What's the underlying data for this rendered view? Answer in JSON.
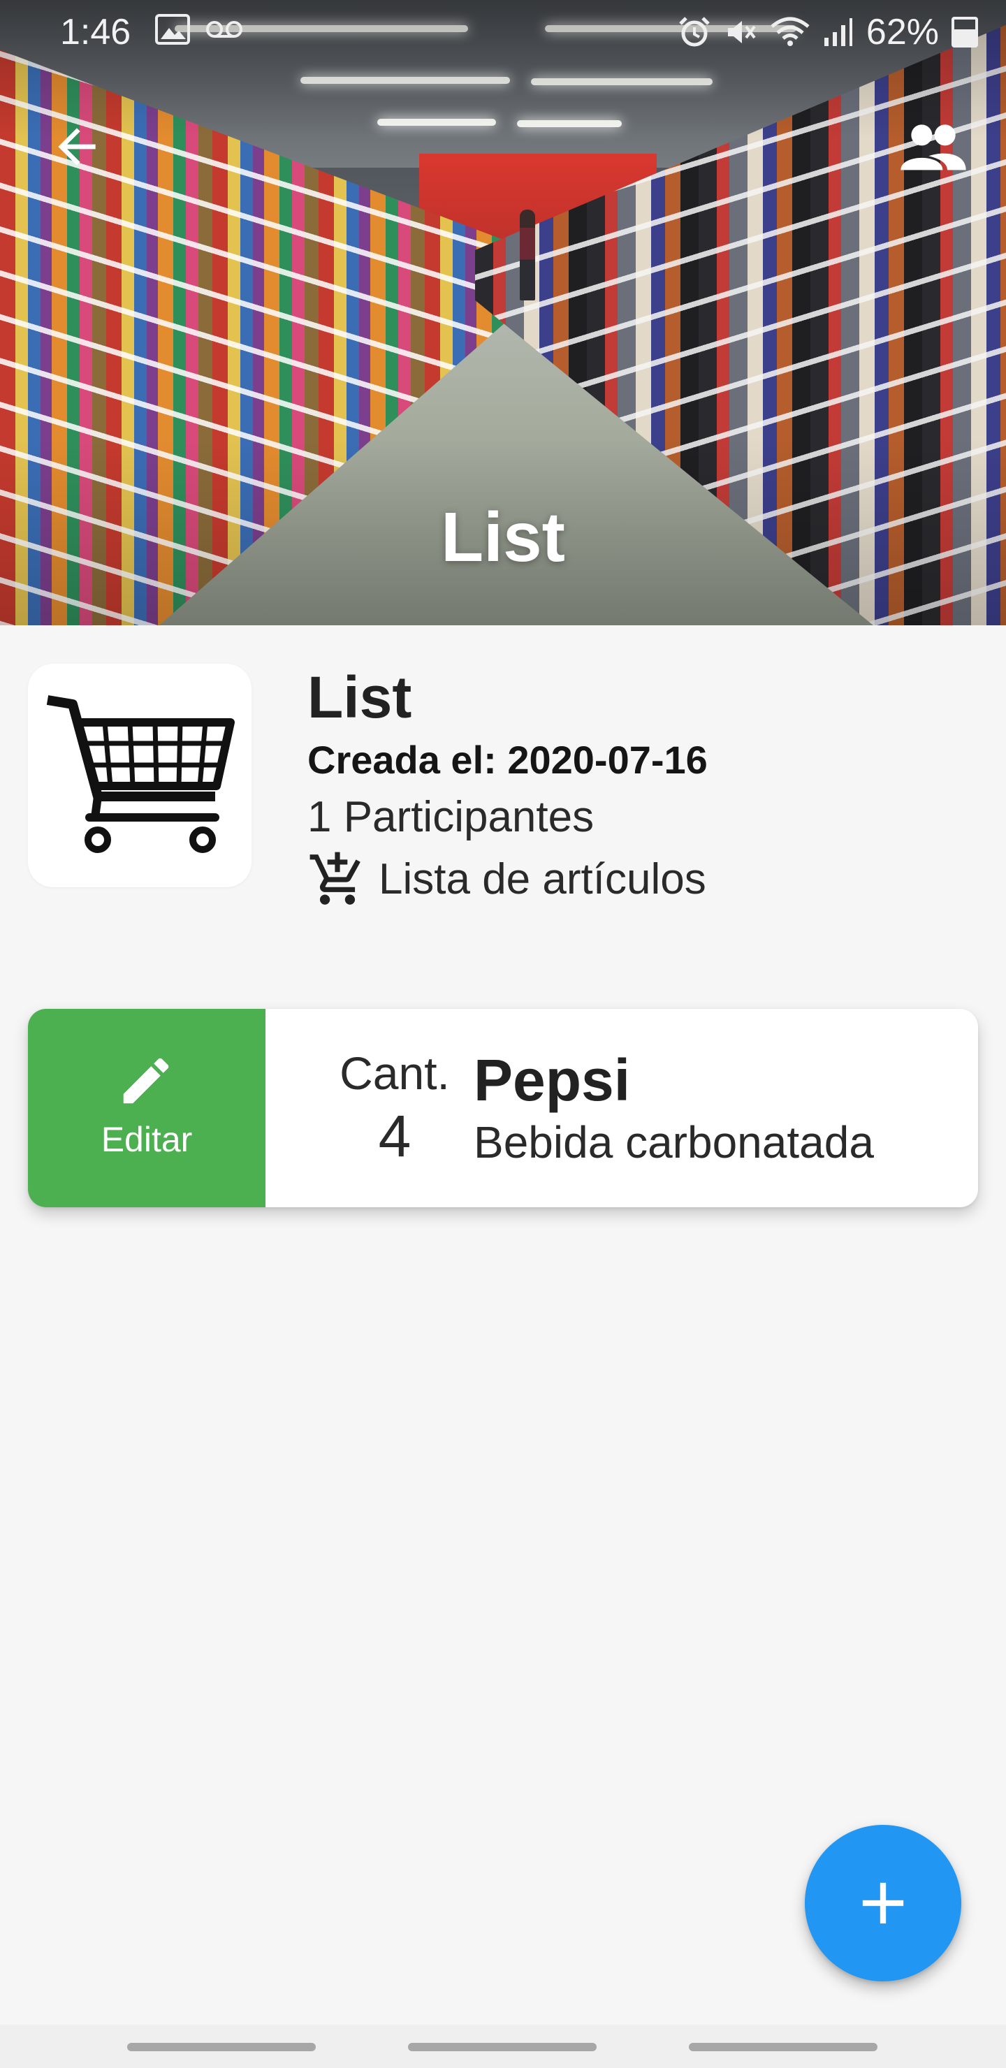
{
  "status_bar": {
    "time": "1:46",
    "battery_percent": "62%",
    "left_icons": [
      "image-icon",
      "voicemail-icon"
    ],
    "right_icons": [
      "alarm-icon",
      "mute-icon",
      "wifi-icon",
      "signal-icon",
      "battery-icon"
    ]
  },
  "header": {
    "title": "List",
    "back_icon": "arrow-back-icon",
    "participants_icon": "people-icon"
  },
  "list_info": {
    "title": "List",
    "created": "Creada el: 2020-07-16",
    "participants": "1 Participantes",
    "items_link": "Lista de artículos",
    "image_icon": "shopping-cart-icon"
  },
  "items": [
    {
      "edit_label": "Editar",
      "qty_label": "Cant.",
      "qty": "4",
      "name": "Pepsi",
      "description": "Bebida carbonatada"
    }
  ],
  "fab": {
    "icon": "plus-icon"
  },
  "colors": {
    "edit_green": "#4caf50",
    "fab_blue": "#2196f3",
    "background": "#f6f6f6"
  }
}
